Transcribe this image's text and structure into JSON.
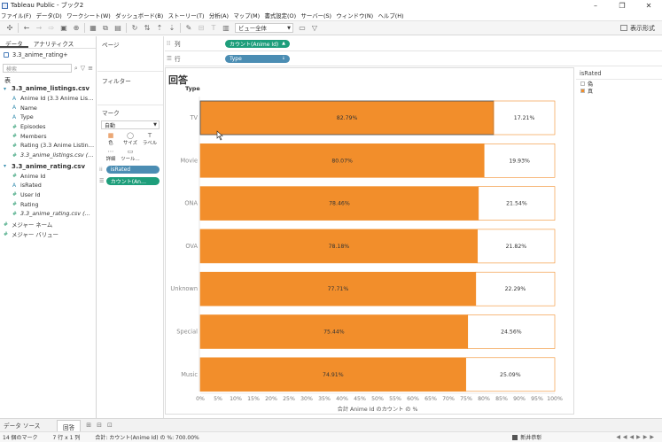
{
  "window": {
    "title": "Tableau Public - ブック2",
    "controls": [
      "–",
      "❐",
      "✕"
    ]
  },
  "menu": [
    "ファイル(F)",
    "データ(D)",
    "ワークシート(W)",
    "ダッシュボード(B)",
    "ストーリー(T)",
    "分析(A)",
    "マップ(M)",
    "書式設定(O)",
    "サーバー(S)",
    "ウィンドウ(N)",
    "ヘルプ(H)"
  ],
  "toolbar": {
    "view_select": "ビュー全体",
    "show_me": "表示形式"
  },
  "datapane": {
    "tabs": [
      "データ",
      "アナリティクス"
    ],
    "source": "3.3_anime_rating+",
    "search_placeholder": "検索",
    "section": "表",
    "tables": [
      {
        "name": "3.3_anime_listings.csv",
        "fields": [
          {
            "label": "Anime Id (3.3 Anime Lis…",
            "kind": "dim",
            "italic": false
          },
          {
            "label": "Name",
            "kind": "dim",
            "italic": false
          },
          {
            "label": "Type",
            "kind": "dim",
            "italic": false
          },
          {
            "label": "Episodes",
            "kind": "meas",
            "italic": false
          },
          {
            "label": "Members",
            "kind": "meas",
            "italic": false
          },
          {
            "label": "Rating (3.3 Anime Listin…",
            "kind": "meas",
            "italic": false
          },
          {
            "label": "3.3_anime_listings.csv (…",
            "kind": "meas",
            "italic": true
          }
        ]
      },
      {
        "name": "3.3_anime_rating.csv",
        "fields": [
          {
            "label": "Anime Id",
            "kind": "meas",
            "italic": false
          },
          {
            "label": "isRated",
            "kind": "dim",
            "italic": false
          },
          {
            "label": "User Id",
            "kind": "meas",
            "italic": false
          },
          {
            "label": "Rating",
            "kind": "meas",
            "italic": false
          },
          {
            "label": "3.3_anime_rating.csv (…",
            "kind": "meas",
            "italic": true
          }
        ]
      }
    ],
    "bottom": [
      "メジャー ネーム",
      "メジャー バリュー"
    ]
  },
  "sidebar": {
    "pages": "ページ",
    "filters": "フィルター",
    "marks": "マーク",
    "mark_type": "自動",
    "mark_buttons": [
      {
        "icon": "▦",
        "label": "色",
        "color": true
      },
      {
        "icon": "◯",
        "label": "サイズ",
        "color": false
      },
      {
        "icon": "T",
        "label": "ラベル",
        "color": false
      },
      {
        "icon": "⋯",
        "label": "詳細",
        "color": false
      },
      {
        "icon": "▭",
        "label": "ツール…",
        "color": false
      }
    ],
    "mark_pills": [
      {
        "icon": "⁞⁞",
        "label": "isRated",
        "style": "blue"
      },
      {
        "icon": "☰",
        "label": "カウント(An…",
        "style": "green"
      }
    ]
  },
  "shelves": {
    "columns_label": "列",
    "rows_label": "行",
    "columns_pill": "カウント(Anime Id)",
    "rows_pill": "Type"
  },
  "viz": {
    "title": "回答",
    "row_header": "Type"
  },
  "legend": {
    "title": "isRated",
    "items": [
      {
        "label": "偽",
        "color": "#ffffff"
      },
      {
        "label": "真",
        "color": "#f28e2b"
      }
    ]
  },
  "chart_data": {
    "type": "bar",
    "stacked": true,
    "categories": [
      "TV",
      "Movie",
      "ONA",
      "OVA",
      "Unknown",
      "Special",
      "Music"
    ],
    "series": [
      {
        "name": "真",
        "color": "#f28e2b",
        "values": [
          82.79,
          80.07,
          78.46,
          78.18,
          77.71,
          75.44,
          74.91
        ]
      },
      {
        "name": "偽",
        "color": "#ffffff",
        "values": [
          17.21,
          19.93,
          21.54,
          21.82,
          22.29,
          24.56,
          25.09
        ]
      }
    ],
    "labels_true": [
      "82.79%",
      "80.07%",
      "78.46%",
      "78.18%",
      "77.71%",
      "75.44%",
      "74.91%"
    ],
    "labels_false": [
      "17.21%",
      "19.93%",
      "21.54%",
      "21.82%",
      "22.29%",
      "24.56%",
      "25.09%"
    ],
    "xticks": [
      "0%",
      "5%",
      "10%",
      "15%",
      "20%",
      "25%",
      "30%",
      "35%",
      "40%",
      "45%",
      "50%",
      "55%",
      "60%",
      "65%",
      "70%",
      "75%",
      "80%",
      "85%",
      "90%",
      "95%",
      "100%"
    ],
    "xlim": [
      0,
      100
    ],
    "xlabel": "合計 Anime Id のカウント の %",
    "bar_border": "#f28e2b",
    "highlight_index": 0
  },
  "sheet": {
    "datasource_tab": "データ ソース",
    "sheet_tab": "回答"
  },
  "status": {
    "marks": "14 個のマーク",
    "dims": "7 行 x 1 列",
    "sum": "合計: カウント(Anime Id) の %: 700.00%",
    "user": "新井恭彰"
  }
}
